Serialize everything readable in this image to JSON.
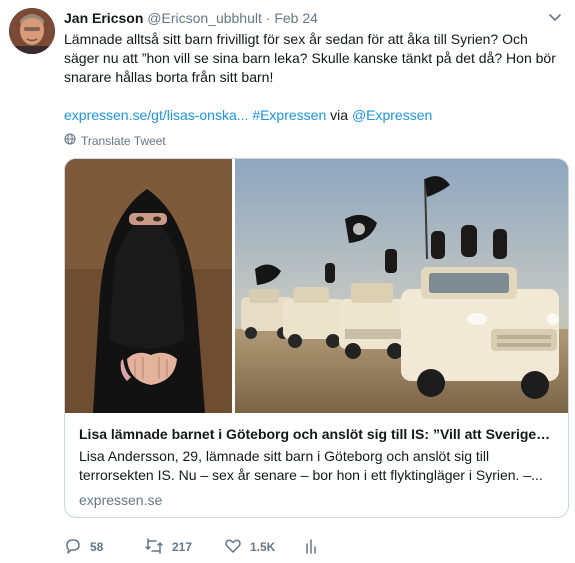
{
  "tweet": {
    "display_name": "Jan Ericson",
    "handle": "@Ericson_ubbhult",
    "separator": "·",
    "date": "Feb 24",
    "text": "Lämnade alltså sitt barn frivilligt för sex år sedan för att åka till Syrien? Och säger nu att ”hon vill se sina barn leka? Skulle kanske tänkt på det då? Hon bör snarare hållas borta från sitt barn!",
    "link_url": "expressen.se/gt/lisas-onska...",
    "hashtag": "#Expressen",
    "via_word": "via",
    "mention": "@Expressen",
    "translate_label": "Translate Tweet"
  },
  "card": {
    "title": "Lisa lämnade barnet i Göteborg och anslöt sig till IS: ”Vill att Sverige…",
    "description": "Lisa Andersson, 29, lämnade sitt barn i Göteborg och anslöt sig till terrorsekten IS. Nu – sex år senare – bor hon i ett flyktingläger i Syrien. –...",
    "domain": "expressen.se"
  },
  "actions": {
    "replies": "58",
    "retweets": "217",
    "likes": "1.5K"
  },
  "icons": {
    "reply": "reply-icon",
    "retweet": "retweet-icon",
    "like": "heart-icon",
    "analytics": "analytics-icon",
    "translate": "globe-icon",
    "caret": "chevron-down-icon"
  },
  "colors": {
    "link": "#1b95e0",
    "secondary_text": "#657786",
    "primary_text": "#14171a",
    "card_border": "#ccd6dd"
  }
}
